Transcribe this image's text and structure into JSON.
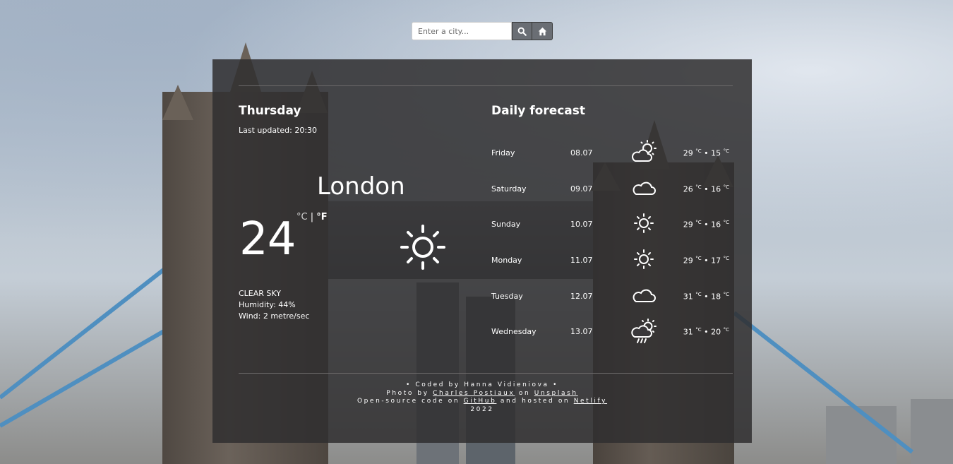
{
  "search": {
    "placeholder": "Enter a city..."
  },
  "icons": {
    "search": "search-icon",
    "home": "home-icon"
  },
  "current": {
    "day": "Thursday",
    "last_updated": "Last updated: 20:30",
    "city": "London",
    "temperature": "24",
    "unit_c": "°C",
    "unit_sep": "|",
    "unit_f": "°F",
    "icon": "clear-sky-sun-icon",
    "description": "CLEAR SKY",
    "humidity": "Humidity: 44%",
    "wind": "Wind: 2 metre/sec"
  },
  "forecast": {
    "title": "Daily forecast",
    "days": [
      {
        "day": "Friday",
        "date": "08.07",
        "icon": "partly-cloudy-icon",
        "max": "29",
        "min": "15"
      },
      {
        "day": "Saturday",
        "date": "09.07",
        "icon": "cloud-icon",
        "max": "26",
        "min": "16"
      },
      {
        "day": "Sunday",
        "date": "10.07",
        "icon": "sun-icon",
        "max": "29",
        "min": "16"
      },
      {
        "day": "Monday",
        "date": "11.07",
        "icon": "sun-icon",
        "max": "29",
        "min": "17"
      },
      {
        "day": "Tuesday",
        "date": "12.07",
        "icon": "cloud-icon",
        "max": "31",
        "min": "18"
      },
      {
        "day": "Wednesday",
        "date": "13.07",
        "icon": "rain-sun-icon",
        "max": "31",
        "min": "20"
      }
    ],
    "unit": "°C",
    "separator": "•"
  },
  "footer": {
    "line1": "• Coded by Hanna Vidieniova •",
    "line2_prefix": "Photo by",
    "photographer": "Charles Postiaux",
    "line2_mid": "on",
    "photo_site": "Unsplash",
    "line3_prefix": "Open-source code on",
    "code_site": "GitHub",
    "line3_mid": "and hosted on",
    "host_site": "Netlify",
    "year": "2022"
  }
}
